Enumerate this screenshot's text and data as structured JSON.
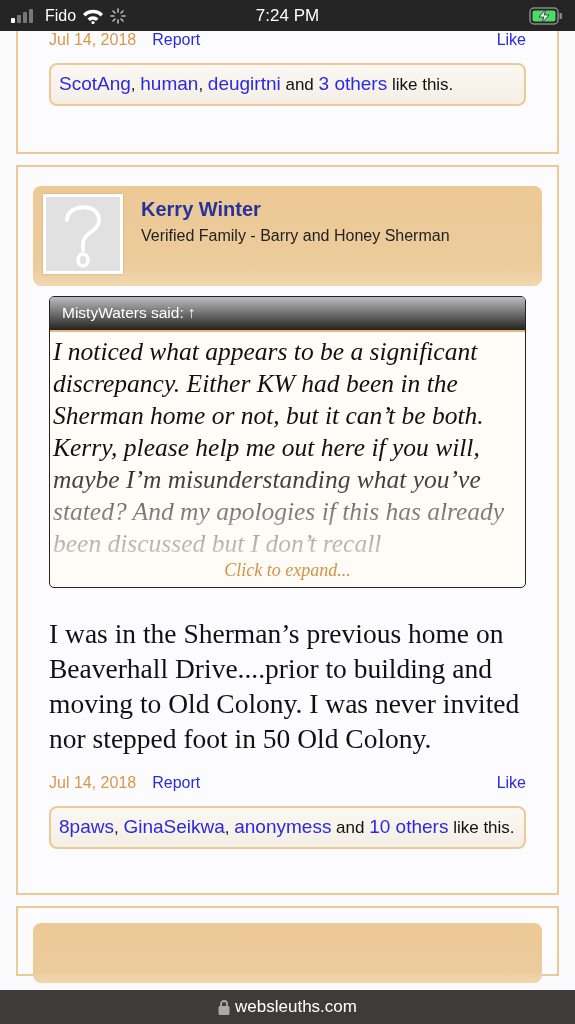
{
  "status_bar": {
    "carrier": "Fido",
    "time": "7:24 PM"
  },
  "posts": [
    {
      "kind": "tail",
      "date": "Jul 14, 2018",
      "report": "Report",
      "like": "Like",
      "likes": [
        {
          "text": "ScotAng",
          "link": true
        },
        {
          "text": ", ",
          "link": false
        },
        {
          "text": "human",
          "link": true
        },
        {
          "text": ", ",
          "link": false
        },
        {
          "text": "deugirtni",
          "link": true
        },
        {
          "text": " and ",
          "link": false
        },
        {
          "text": "3 others",
          "link": true
        },
        {
          "text": " like this.",
          "link": false
        }
      ]
    },
    {
      "kind": "full",
      "author": "Kerry Winter",
      "title": "Verified Family - Barry and Honey Sherman",
      "quote": {
        "header": "MistyWaters said: ↑",
        "text": "I noticed what appears to be a significant discrepancy. Either KW had been in the Sherman home or not, but it can’t be both. Kerry, please help me out here if you will, maybe I’m misunderstanding what you’ve stated? And my apologies if this has already been discussed but I don’t recall",
        "expand": "Click to expand..."
      },
      "message": "I was in the Sherman’s previous home on Beaverhall Drive....prior to building and moving to Old Colony. I was never invited nor stepped foot in 50 Old Colony.",
      "date": "Jul 14, 2018",
      "report": "Report",
      "like": "Like",
      "likes": [
        {
          "text": "8paws",
          "link": true
        },
        {
          "text": ", ",
          "link": false
        },
        {
          "text": "GinaSeikwa",
          "link": true
        },
        {
          "text": ", ",
          "link": false
        },
        {
          "text": "anonymess",
          "link": true
        },
        {
          "text": " and ",
          "link": false
        },
        {
          "text": "10 others",
          "link": true
        },
        {
          "text": " like this.",
          "link": false
        }
      ]
    },
    {
      "kind": "head"
    }
  ],
  "address_bar": {
    "domain": "websleuths.com"
  }
}
